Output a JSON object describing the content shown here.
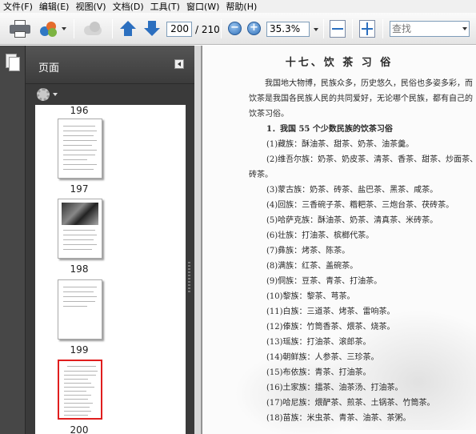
{
  "menu": [
    "文件(F)",
    "编辑(E)",
    "视图(V)",
    "文档(D)",
    "工具(T)",
    "窗口(W)",
    "帮助(H)"
  ],
  "toolbar": {
    "current_page": "200",
    "page_total": "/ 210",
    "zoom_out": "−",
    "zoom_in": "+",
    "zoom": "35.3%",
    "search_placeholder": "查找"
  },
  "panel": {
    "title": "页面",
    "thumbnails": [
      {
        "label": "196"
      },
      {
        "label": "197"
      },
      {
        "label": "198"
      },
      {
        "label": "199"
      },
      {
        "label": "200"
      }
    ]
  },
  "document": {
    "title": "十七、饮 茶 习 俗",
    "intro": [
      "我国地大物博，民族众多，历史悠久，民俗也多姿多彩，而",
      "饮茶是我国各民族人民的共同爱好，无论哪个民族，都有自己的",
      "饮茶习俗。"
    ],
    "section": "1．我国 55 个少数民族的饮茶习俗",
    "items": [
      "(1)藏族：酥油茶、甜茶、奶茶、油茶羹。",
      "(2)维吾尔族：奶茶、奶皮茶、清茶、香茶、甜茶、炒面茶、茯",
      "砖茶。",
      "(3)蒙古族：奶茶、砖茶、盐巴茶、黑茶、咸茶。",
      "(4)回族：三香碗子茶、糌粑茶、三炮台茶、茯砖茶。",
      "(5)哈萨克族：酥油茶、奶茶、清真茶、米砖茶。",
      "(6)壮族：打油茶、槟榔代茶。",
      "(7)彝族：烤茶、陈茶。",
      "(8)满族：红茶、盖碗茶。",
      "(9)侗族：豆茶、青茶、打油茶。",
      "(10)黎族：黎茶、芎茶。",
      "(11)白族：三道茶、烤茶、雷响茶。",
      "(12)傣族：竹筒香茶、煨茶、烧茶。",
      "(13)瑶族：打油茶、滚郎茶。",
      "(14)朝鲜族：人参茶、三珍茶。",
      "(15)布依族：青茶、打油茶。",
      "(16)土家族：擂茶、油茶汤、打油茶。",
      "(17)哈尼族：煨酽茶、煎茶、土锅茶、竹筒茶。",
      "(18)苗族：米虫茶、青茶、油茶、茶粥。"
    ]
  }
}
